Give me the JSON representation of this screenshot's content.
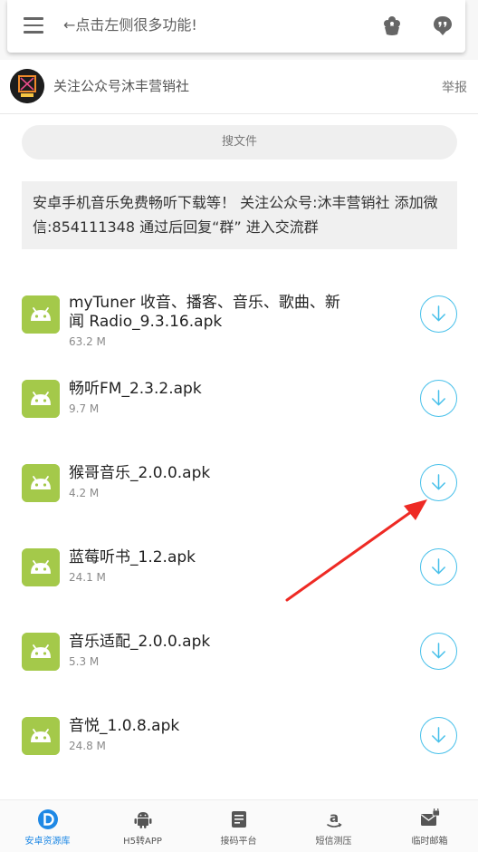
{
  "topbar": {
    "hint_text": "←点击左侧很多功能!",
    "icons": [
      "menu-icon",
      "settings-flower-icon",
      "quote-bubble-icon"
    ]
  },
  "channel": {
    "name": "关注公众号沐丰营销社",
    "report_label": "举报"
  },
  "search": {
    "label": "搜文件"
  },
  "notice": {
    "text": "安卓手机音乐免费畅听下载等！ 关注公众号:沐丰营销社 添加微信:854111348 通过后回复“群” 进入交流群"
  },
  "files": [
    {
      "name": "myTuner 收音、播客、音乐、歌曲、新闻 Radio_9.3.16.apk",
      "size": "63.2 M"
    },
    {
      "name": "畅听FM_2.3.2.apk",
      "size": "9.7 M"
    },
    {
      "name": "猴哥音乐_2.0.0.apk",
      "size": "4.2 M"
    },
    {
      "name": "蓝莓听书_1.2.apk",
      "size": "24.1 M"
    },
    {
      "name": "音乐适配_2.0.0.apk",
      "size": "5.3 M"
    },
    {
      "name": "音悦_1.0.8.apk",
      "size": "24.8 M"
    }
  ],
  "bottom_nav": [
    {
      "label": "安卓资源库",
      "icon": "d-logo-icon",
      "active": true
    },
    {
      "label": "H5转APP",
      "icon": "android-icon",
      "active": false
    },
    {
      "label": "接码平台",
      "icon": "document-icon",
      "active": false
    },
    {
      "label": "短信测压",
      "icon": "amazon-icon",
      "active": false
    },
    {
      "label": "临时邮箱",
      "icon": "mail-lock-icon",
      "active": false
    }
  ],
  "colors": {
    "accent": "#1e88e5",
    "download_ring": "#47c0ea",
    "apk_icon": "#a4c94a",
    "annotation_arrow": "#ee2a24"
  }
}
